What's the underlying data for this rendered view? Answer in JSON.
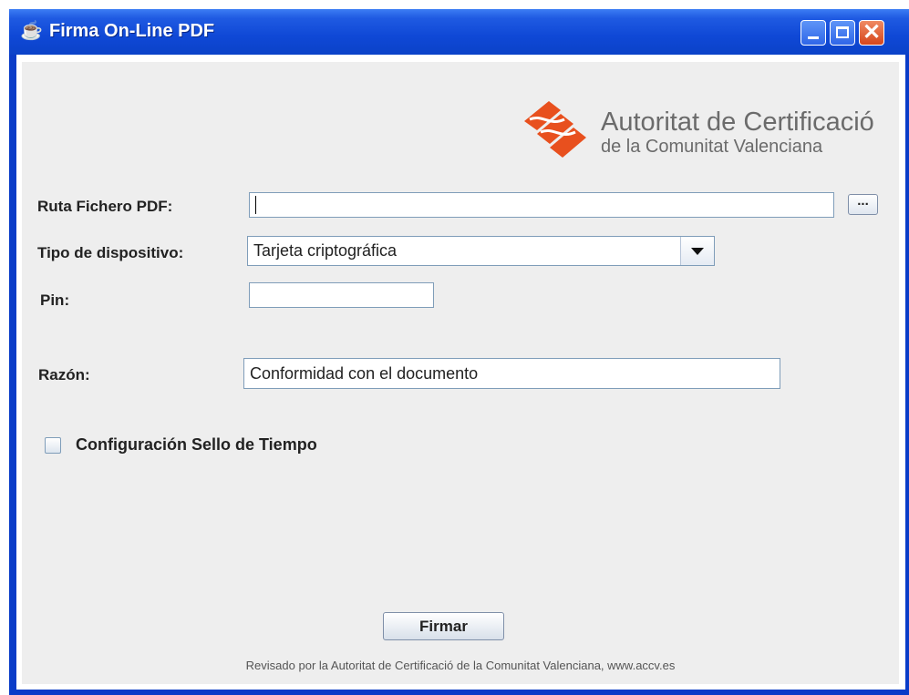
{
  "window": {
    "title": "Firma On-Line PDF"
  },
  "logo": {
    "line1": "Autoritat de Certificació",
    "line2": "de la Comunitat Valenciana"
  },
  "form": {
    "ruta_label": "Ruta Fichero PDF:",
    "ruta_value": "",
    "browse_label": "...",
    "tipo_label": "Tipo de dispositivo:",
    "tipo_value": "Tarjeta criptográfica",
    "pin_label": "Pin:",
    "pin_value": "",
    "razon_label": "Razón:",
    "razon_value": "Conformidad con el documento",
    "sello_label": "Configuración Sello de Tiempo",
    "firmar_label": "Firmar"
  },
  "footer": {
    "text": "Revisado por la Autoritat de Certificació de la Comunitat Valenciana, www.accv.es"
  },
  "icons": {
    "app": "java-cup-icon",
    "minimize": "minimize-icon",
    "maximize": "maximize-icon",
    "close": "close-icon",
    "dropdown": "chevron-down-icon"
  },
  "colors": {
    "titlebar": "#0b42c8",
    "logo_orange": "#e8501e",
    "panel": "#eeeeee"
  }
}
